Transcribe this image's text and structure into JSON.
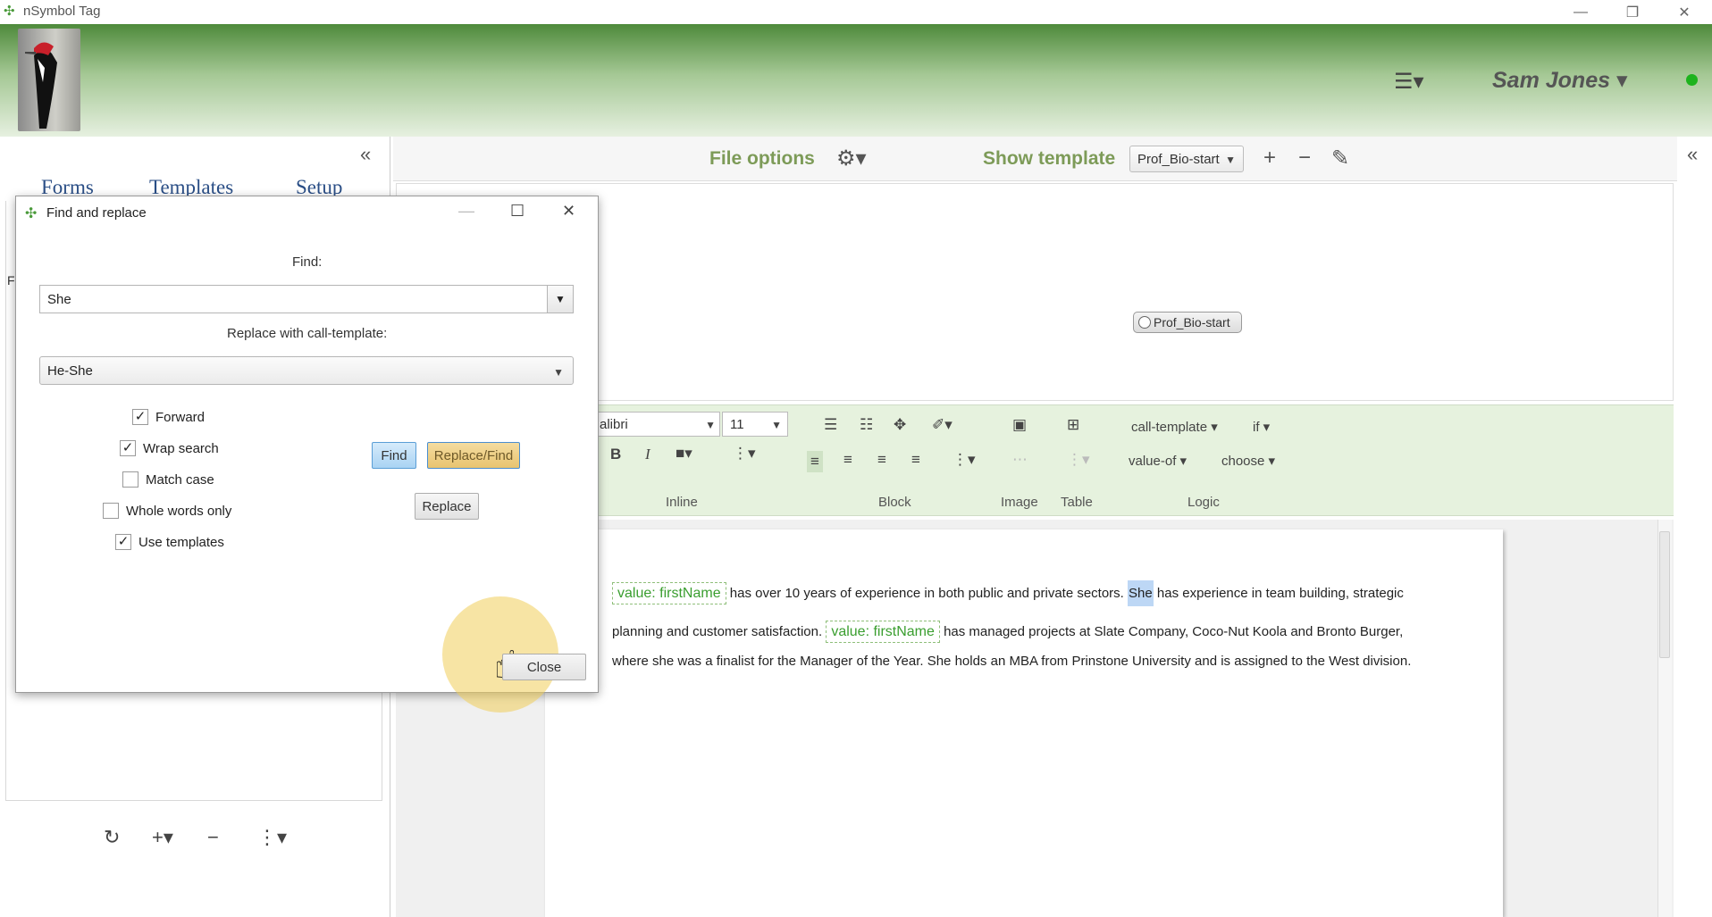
{
  "window": {
    "title": "nSymbol Tag"
  },
  "header": {
    "user_name": "Sam Jones ▾",
    "menu_icon": "hamburger-menu-icon"
  },
  "left_panel": {
    "tabs": [
      "Forms",
      "Templates",
      "Setup"
    ],
    "collapse_icon": "«",
    "fragment_label": "F"
  },
  "top_bar": {
    "file_options": "File options",
    "show_template": "Show template",
    "template_selected": "Prof_Bio-start",
    "plus": "+",
    "minus": "−"
  },
  "preview": {
    "node_label": "Prof_Bio-start"
  },
  "toolbar": {
    "font": "alibri",
    "size": "11",
    "bold": "B",
    "italic": "I",
    "call_template": "call-template",
    "if": "if",
    "value_of": "value-of",
    "choose": "choose",
    "sections": [
      "Inline",
      "Block",
      "Image",
      "Table",
      "Logic"
    ]
  },
  "editor": {
    "line1_tag": "value: firstName",
    "line1_pre": " has over 10 years of experience in both public and private sectors. ",
    "line1_hl": "She",
    "line1_post": " has experience in team building, strategic",
    "line2_pre": "planning and customer satisfaction. ",
    "line2_tag": "value: firstName",
    "line2_post": " has managed projects at Slate Company, Coco-Nut Koola and Bronto Burger,",
    "line3": "where she was a finalist for the Manager of the Year. She holds an MBA from Prinstone University and is assigned to the West division."
  },
  "dialog": {
    "title": "Find and replace",
    "find_label": "Find:",
    "find_value": "She",
    "replace_label": "Replace with call-template:",
    "replace_value": "He-She",
    "options": [
      {
        "label": "Forward",
        "checked": true
      },
      {
        "label": "Wrap search",
        "checked": true
      },
      {
        "label": "Match case",
        "checked": false
      },
      {
        "label": "Whole words only",
        "checked": false
      },
      {
        "label": "Use templates",
        "checked": true
      }
    ],
    "find_button": "Find",
    "replace_find_button": "Replace/Find",
    "replace_button": "Replace",
    "close_button": "Close"
  }
}
